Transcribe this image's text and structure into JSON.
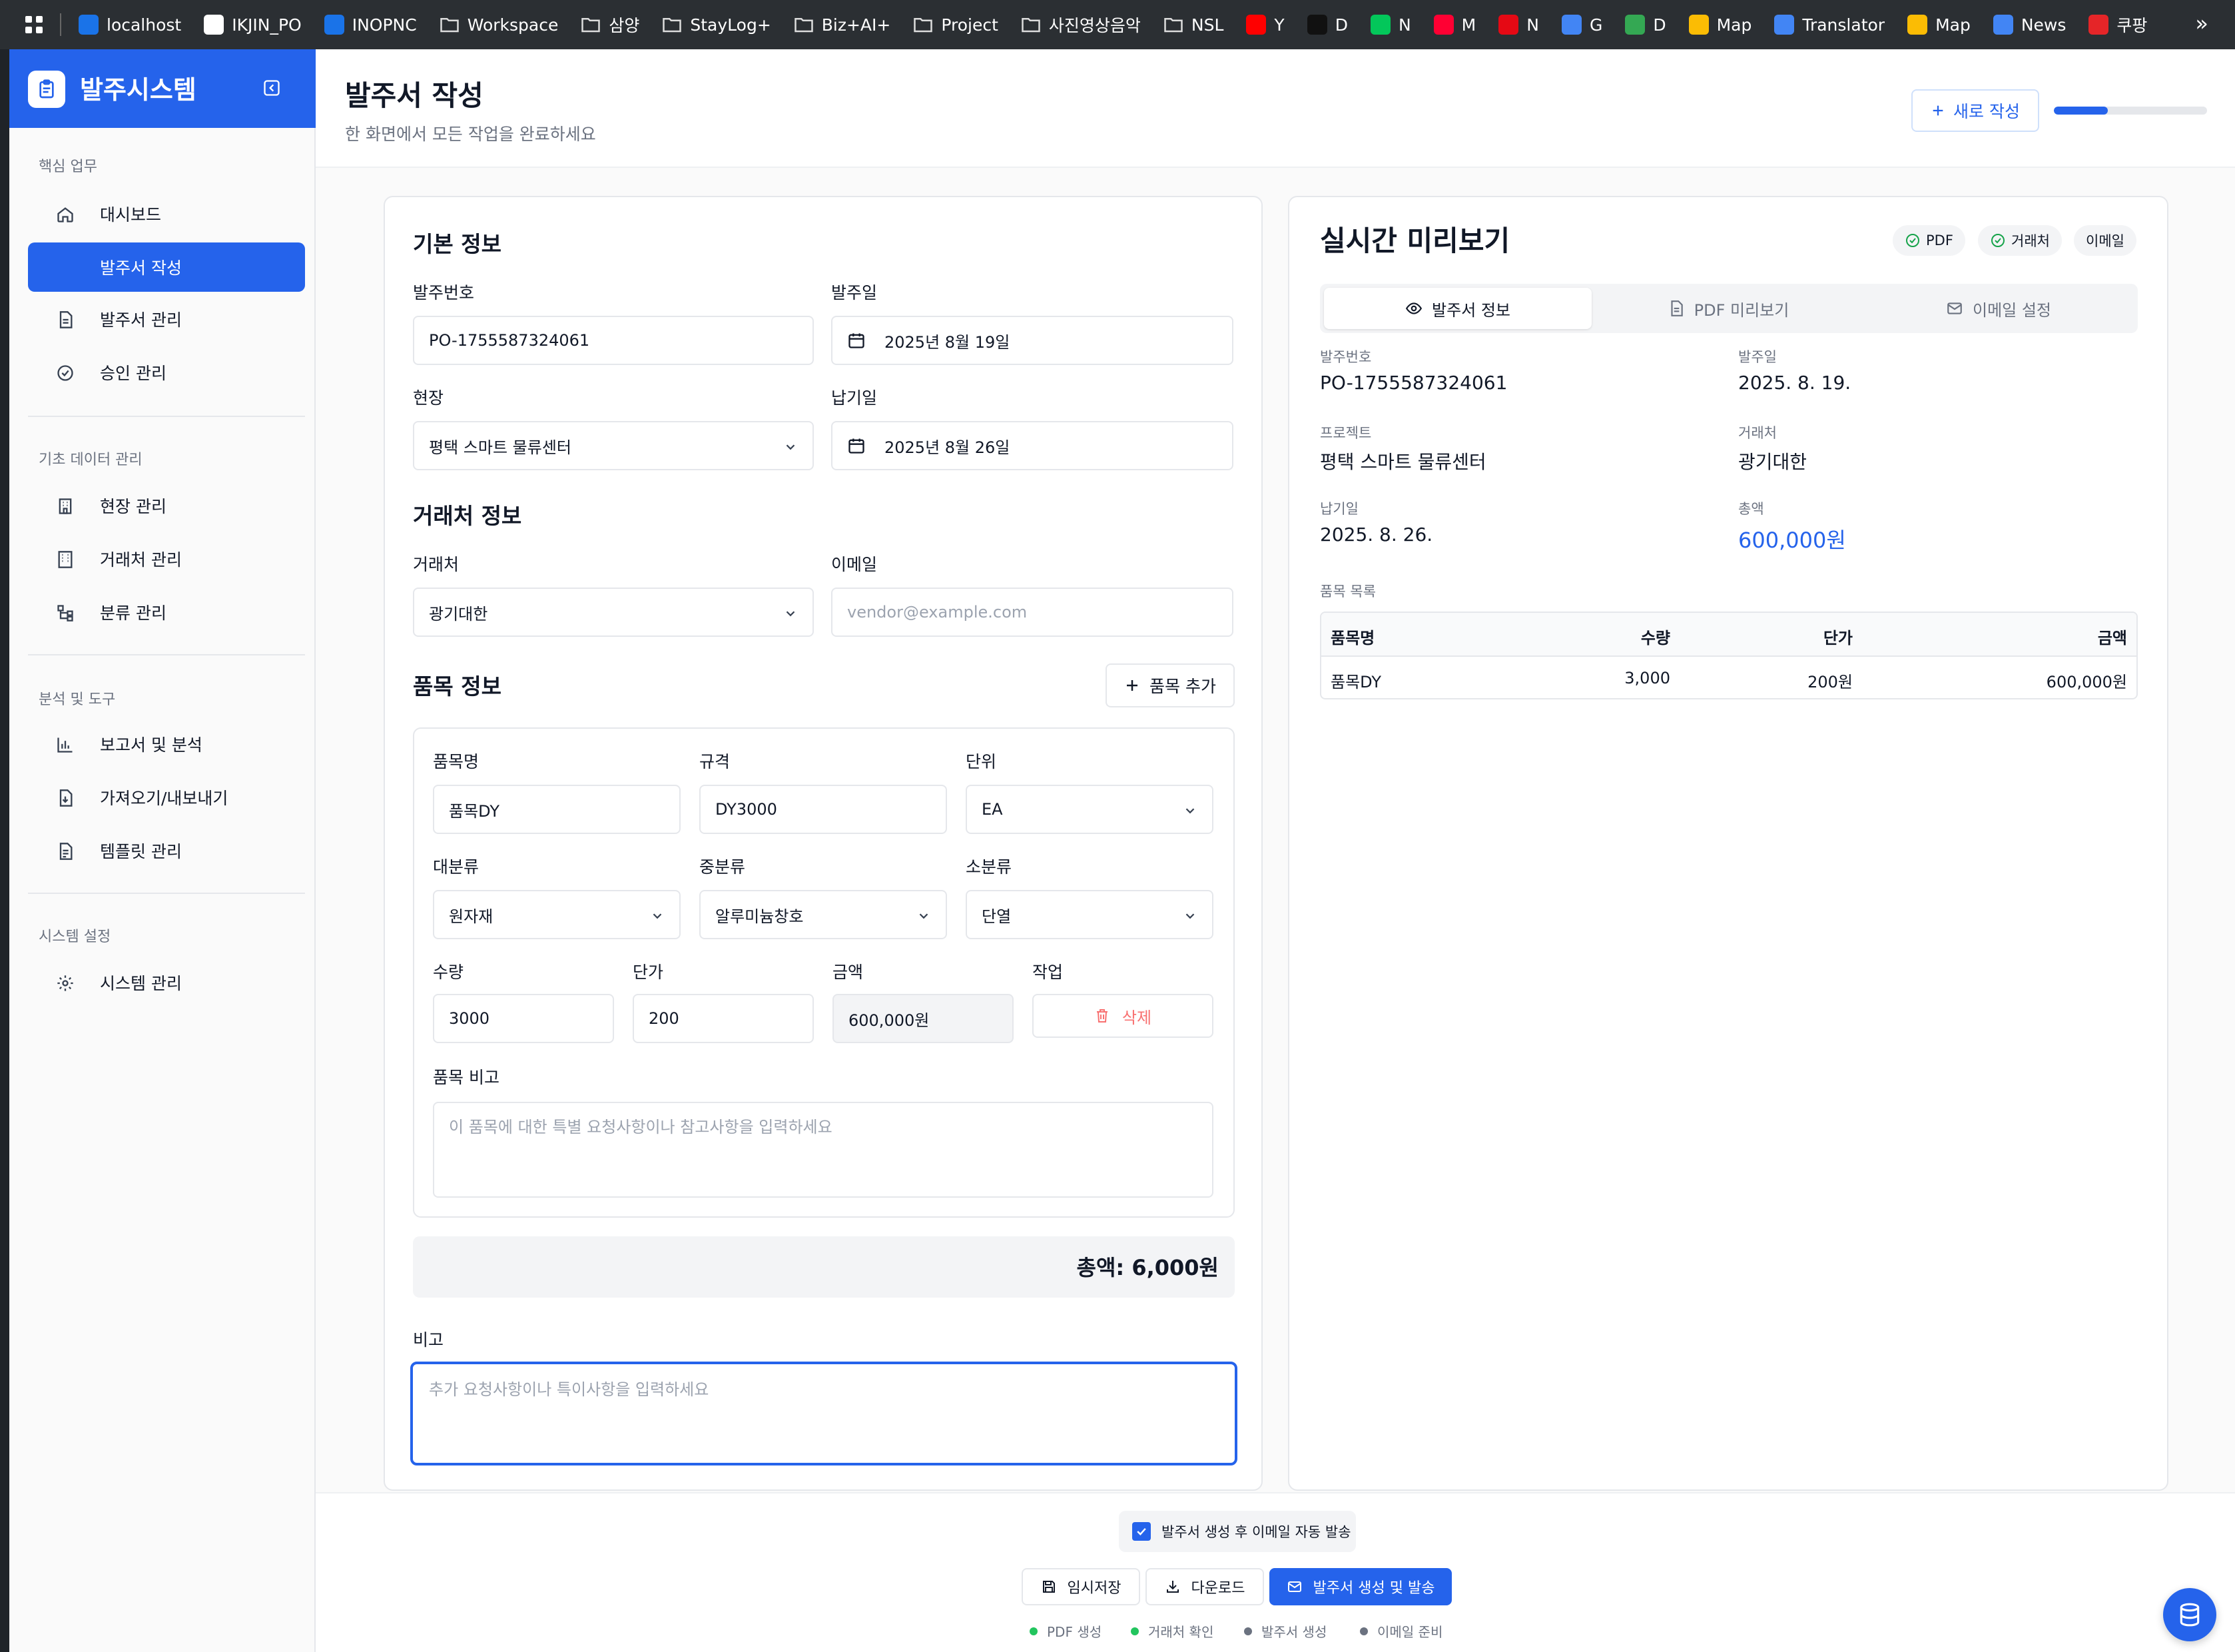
{
  "bookmarks": [
    {
      "label": "localhost",
      "color": "#1a73e8"
    },
    {
      "label": "IKJIN_PO",
      "color": "#ffffff"
    },
    {
      "label": "INOPNC",
      "color": "#1a73e8"
    },
    {
      "label": "Workspace",
      "icon": "folder-icon"
    },
    {
      "label": "삼양",
      "icon": "folder-icon"
    },
    {
      "label": "StayLog+",
      "icon": "folder-icon"
    },
    {
      "label": "Biz+AI+",
      "icon": "folder-icon"
    },
    {
      "label": "Project",
      "icon": "folder-icon"
    },
    {
      "label": "사진영상음악",
      "icon": "folder-icon"
    },
    {
      "label": "NSL",
      "icon": "folder-icon"
    },
    {
      "label": "Y",
      "color": "#ff0000"
    },
    {
      "label": "D",
      "color": "#111111"
    },
    {
      "label": "N",
      "color": "#03c75a"
    },
    {
      "label": "M",
      "color": "#ff0033"
    },
    {
      "label": "N",
      "color": "#e50914"
    },
    {
      "label": "G",
      "color": "#4285f4"
    },
    {
      "label": "D",
      "color": "#34a853"
    },
    {
      "label": "Map",
      "color": "#fbbc04"
    },
    {
      "label": "Translator",
      "color": "#4285f4"
    },
    {
      "label": "Map",
      "color": "#fbbc04"
    },
    {
      "label": "News",
      "color": "#4285f4"
    },
    {
      "label": "쿠팡",
      "color": "#e52528"
    }
  ],
  "bookmarks_more": "»",
  "sidebar": {
    "title": "발주시스템",
    "groups": {
      "core": "핵심 업무",
      "base": "기초 데이터 관리",
      "analysis": "분석 및 도구",
      "system": "시스템 설정"
    },
    "items": [
      {
        "label": "대시보드",
        "icon": "home-icon"
      },
      {
        "label": "발주서 작성",
        "icon": "",
        "active": true
      },
      {
        "label": "발주서 관리",
        "icon": "document-icon"
      },
      {
        "label": "승인 관리",
        "icon": "check-circle-icon"
      },
      {
        "label": "현장 관리",
        "icon": "building-icon"
      },
      {
        "label": "거래처 관리",
        "icon": "office-icon"
      },
      {
        "label": "분류 관리",
        "icon": "tree-icon"
      },
      {
        "label": "보고서 및 분석",
        "icon": "bar-chart-icon"
      },
      {
        "label": "가져오기/내보내기",
        "icon": "file-download-icon"
      },
      {
        "label": "템플릿 관리",
        "icon": "template-icon"
      },
      {
        "label": "시스템 관리",
        "icon": "gear-icon"
      }
    ]
  },
  "header": {
    "title": "발주서 작성",
    "subtitle": "한 화면에서 모든 작업을 완료하세요",
    "new_button": "새로 작성",
    "progress": 0.35
  },
  "form": {
    "basic_title": "기본 정보",
    "po_number_label": "발주번호",
    "po_number": "PO-1755587324061",
    "order_date_label": "발주일",
    "order_date": "2025년 8월 19일",
    "site_label": "현장",
    "site": "평택 스마트 물류센터",
    "delivery_label": "납기일",
    "delivery_date": "2025년 8월 26일",
    "vendor_title": "거래처 정보",
    "vendor_label": "거래처",
    "vendor": "광기대한",
    "email_label": "이메일",
    "email_placeholder": "vendor@example.com",
    "items_title": "품목 정보",
    "add_item": "품목 추가",
    "item": {
      "name_label": "품목명",
      "name": "품목DY",
      "spec_label": "규격",
      "spec": "DY3000",
      "unit_label": "단위",
      "unit": "EA",
      "major_label": "대분류",
      "major": "원자재",
      "middle_label": "중분류",
      "middle": "알루미늄창호",
      "minor_label": "소분류",
      "minor": "단열",
      "qty_label": "수량",
      "qty": "3000",
      "price_label": "단가",
      "price": "200",
      "amount_label": "금액",
      "amount": "600,000원",
      "action_label": "작업",
      "delete": "삭제",
      "note_label": "품목 비고",
      "note_placeholder": "이 품목에 대한 특별 요청사항이나 참고사항을 입력하세요"
    },
    "total": "총액: 6,000원",
    "remark_label": "비고",
    "remark_placeholder": "추가 요청사항이나 특이사항을 입력하세요"
  },
  "preview": {
    "title": "실시간 미리보기",
    "chips": [
      "PDF",
      "거래처",
      "이메일"
    ],
    "tabs": [
      "발주서 정보",
      "PDF 미리보기",
      "이메일 설정"
    ],
    "fields": {
      "po_number_label": "발주번호",
      "po_number": "PO-1755587324061",
      "order_date_label": "발주일",
      "order_date": "2025. 8. 19.",
      "project_label": "프로젝트",
      "project": "평택 스마트 물류센터",
      "vendor_label": "거래처",
      "vendor": "광기대한",
      "delivery_label": "납기일",
      "delivery": "2025. 8. 26.",
      "total_label": "총액",
      "total": "600,000원"
    },
    "items_label": "품목 목록",
    "table": {
      "headers": [
        "품목명",
        "수량",
        "단가",
        "금액"
      ],
      "rows": [
        [
          "품목DY",
          "3,000",
          "200원",
          "600,000원"
        ]
      ]
    }
  },
  "footer": {
    "auto_email": "발주서 생성 후 이메일 자동 발송",
    "save": "임시저장",
    "download": "다운로드",
    "generate": "발주서 생성 및 발송",
    "statuses": [
      {
        "label": "PDF 생성",
        "color": "#22c55e"
      },
      {
        "label": "거래처 확인",
        "color": "#22c55e"
      },
      {
        "label": "발주서 생성",
        "color": "#6b7280"
      },
      {
        "label": "이메일 준비",
        "color": "#6b7280"
      }
    ]
  }
}
